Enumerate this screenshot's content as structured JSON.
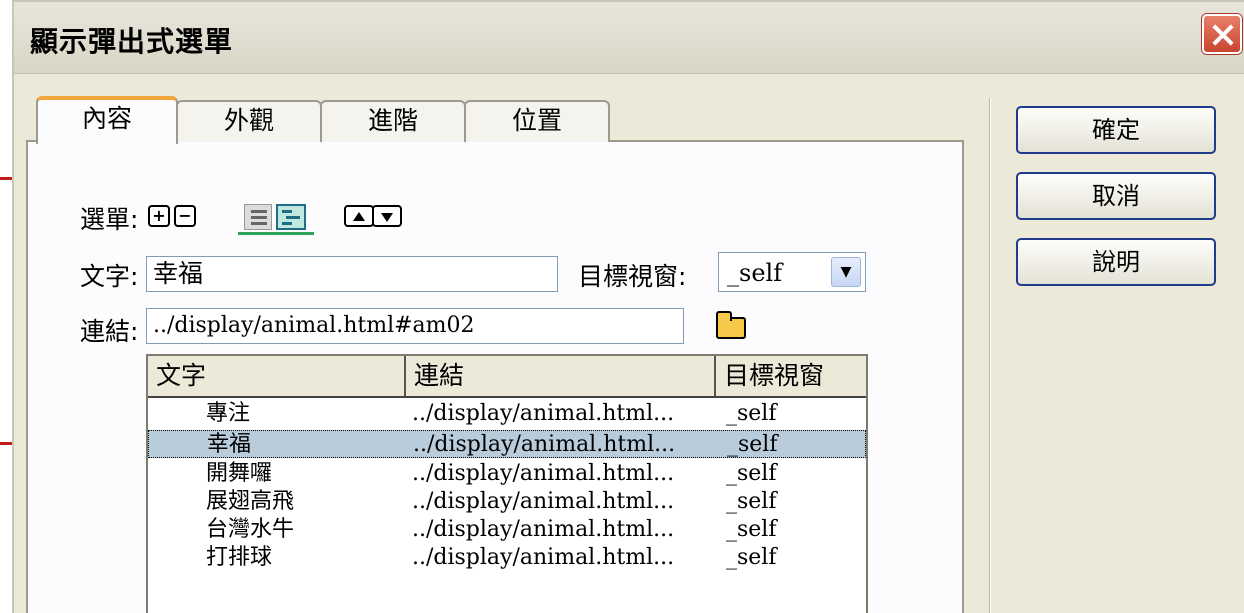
{
  "dialog": {
    "title": "顯示彈出式選單"
  },
  "tabs": [
    {
      "label": "內容",
      "active": true
    },
    {
      "label": "外觀",
      "active": false
    },
    {
      "label": "進階",
      "active": false
    },
    {
      "label": "位置",
      "active": false
    }
  ],
  "buttons": {
    "ok": "確定",
    "cancel": "取消",
    "help": "說明"
  },
  "menu": {
    "label": "選單:",
    "add_symbol": "+",
    "remove_symbol": "−"
  },
  "text_field": {
    "label": "文字:",
    "value": "幸福"
  },
  "target": {
    "label": "目標視窗:",
    "value": "_self"
  },
  "link_field": {
    "label": "連結:",
    "value": "../display/animal.html#am02"
  },
  "list": {
    "headers": [
      "文字",
      "連結",
      "目標視窗"
    ],
    "rows": [
      {
        "text": "專注",
        "link": "../display/animal.html...",
        "target": "_self"
      },
      {
        "text": "幸福",
        "link": "../display/animal.html...",
        "target": "_self"
      },
      {
        "text": "開舞囉",
        "link": "../display/animal.html...",
        "target": "_self"
      },
      {
        "text": "展翅高飛",
        "link": "../display/animal.html...",
        "target": "_self"
      },
      {
        "text": "台灣水牛",
        "link": "../display/animal.html...",
        "target": "_self"
      },
      {
        "text": "打排球",
        "link": "../display/animal.html...",
        "target": "_self"
      }
    ],
    "selected_index": 1
  },
  "colors": {
    "accent_tab": "#f2a63c",
    "annotation": "#c41b1b",
    "selection": "#b8ccdc",
    "close": "#c8452e"
  }
}
